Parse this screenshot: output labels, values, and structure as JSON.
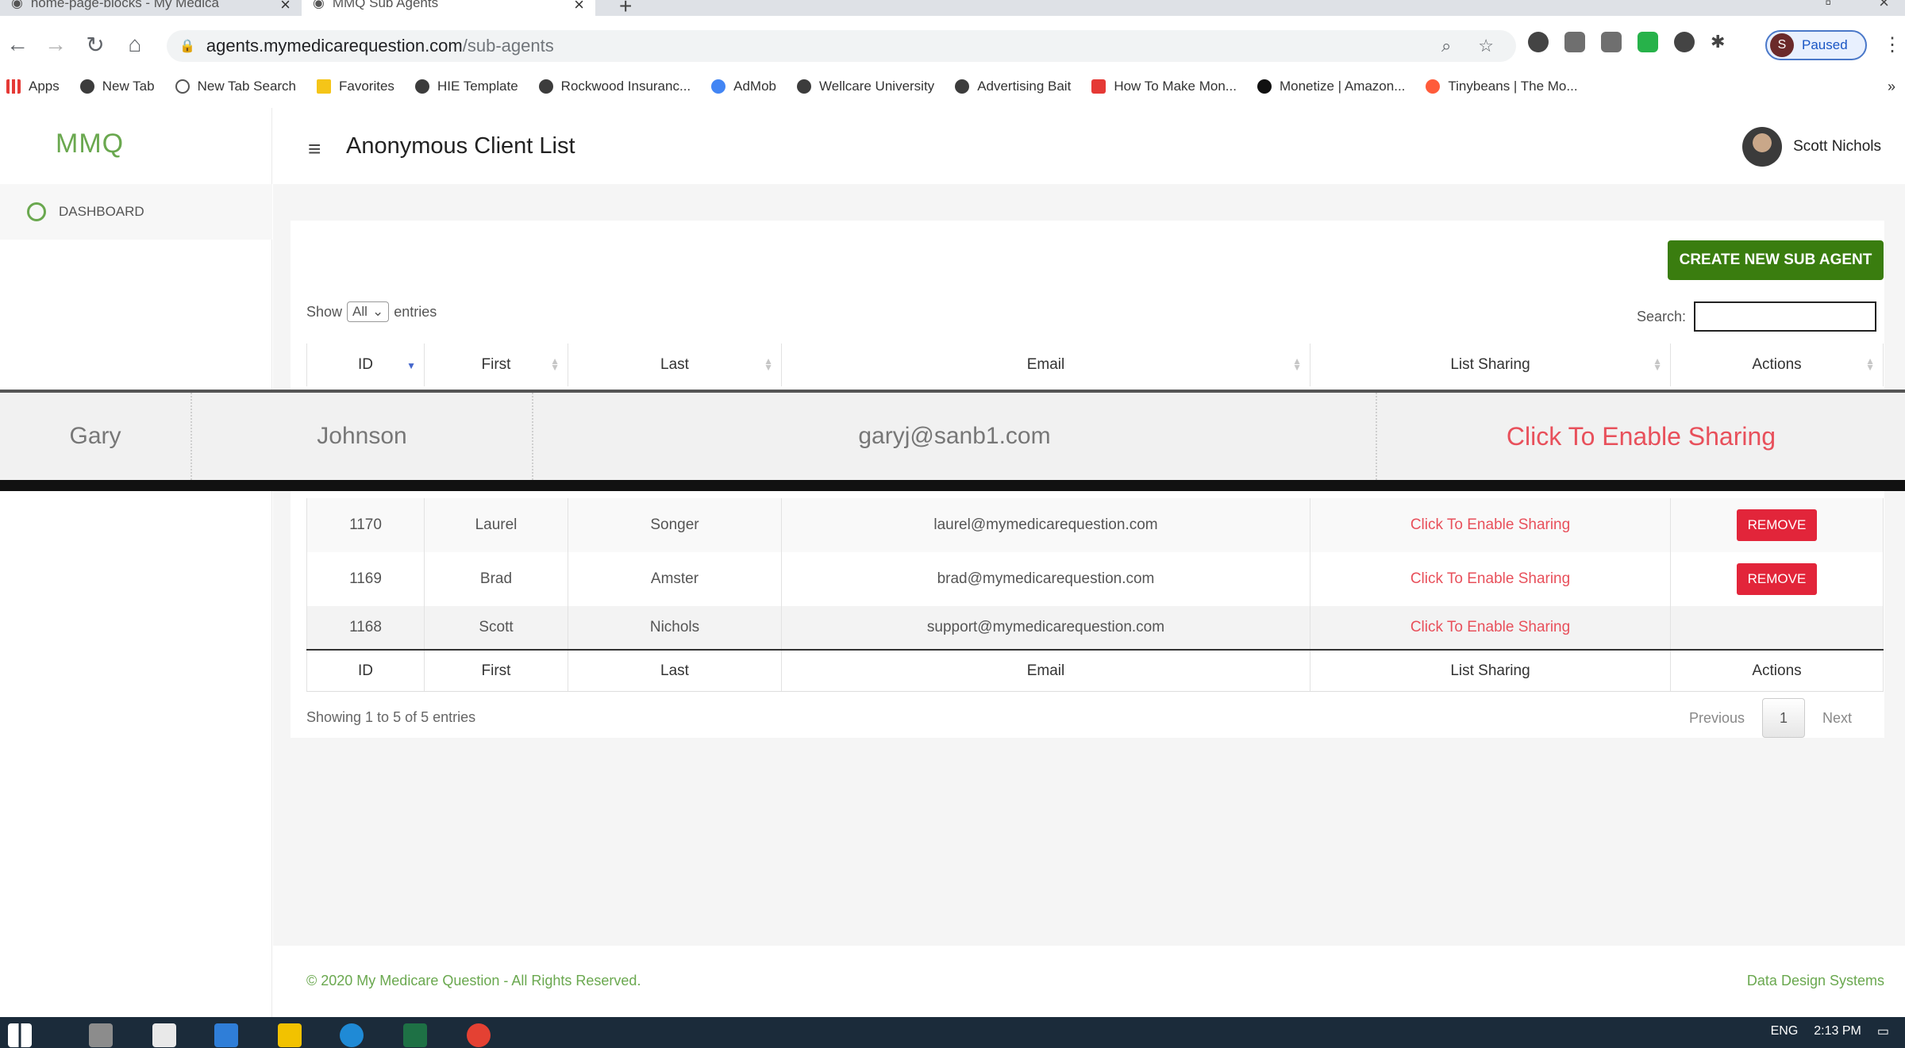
{
  "browser": {
    "tabs": [
      {
        "title": "home-page-blocks - My Medica"
      },
      {
        "title": "MMQ Sub Agents"
      }
    ],
    "url_host": "agents.mymedicarequestion.com",
    "url_path": "/sub-agents",
    "profile_label": "Paused",
    "profile_initial": "S",
    "bookmarks": [
      {
        "label": "Apps",
        "icon": "apps-icon"
      },
      {
        "label": "New Tab",
        "icon": "globe-icon"
      },
      {
        "label": "New Tab Search",
        "icon": "search-icon"
      },
      {
        "label": "Favorites",
        "icon": "folder-icon"
      },
      {
        "label": "HIE Template",
        "icon": "globe-icon"
      },
      {
        "label": "Rockwood Insuranc...",
        "icon": "globe-icon"
      },
      {
        "label": "AdMob",
        "icon": "google-icon"
      },
      {
        "label": "Wellcare University",
        "icon": "globe-icon"
      },
      {
        "label": "Advertising Bait",
        "icon": "globe-icon"
      },
      {
        "label": "How To Make Mon...",
        "icon": "s-logo-icon"
      },
      {
        "label": "Monetize | Amazon...",
        "icon": "amazon-icon"
      },
      {
        "label": "Tinybeans | The Mo...",
        "icon": "tinybeans-icon"
      }
    ],
    "more": "»"
  },
  "app": {
    "logo": "MMQ",
    "sidebar_dashboard": "DASHBOARD",
    "page_title": "Anonymous Client List",
    "user_name": "Scott Nichols",
    "create_button": "CREATE NEW SUB AGENT",
    "show_label": "Show",
    "show_value": "All",
    "entries_label": "entries",
    "search_label": "Search:",
    "columns": [
      "ID",
      "First",
      "Last",
      "Email",
      "List Sharing",
      "Actions"
    ],
    "zoom_row": {
      "first": "Gary",
      "last": "Johnson",
      "email": "garyj@sanb1.com",
      "sharing": "Click To Enable Sharing"
    },
    "rows": [
      {
        "id": "1170",
        "first": "Laurel",
        "last": "Songer",
        "email": "laurel@mymedicarequestion.com",
        "sharing": "Click To Enable Sharing",
        "action": "REMOVE"
      },
      {
        "id": "1169",
        "first": "Brad",
        "last": "Amster",
        "email": "brad@mymedicarequestion.com",
        "sharing": "Click To Enable Sharing",
        "action": "REMOVE"
      },
      {
        "id": "1168",
        "first": "Scott",
        "last": "Nichols",
        "email": "support@mymedicarequestion.com",
        "sharing": "Click To Enable Sharing",
        "action": ""
      }
    ],
    "info": "Showing 1 to 5 of 5 entries",
    "pager": {
      "previous": "Previous",
      "page": "1",
      "next": "Next"
    },
    "copyright": "© 2020 My Medicare Question - All Rights Reserved.",
    "credit": "Data Design Systems"
  },
  "taskbar": {
    "lang": "ENG",
    "time": "2:13 PM"
  },
  "colors": {
    "accent_green": "#3a7d0f",
    "remove_red": "#e2253a",
    "share_link": "#e8505b"
  }
}
